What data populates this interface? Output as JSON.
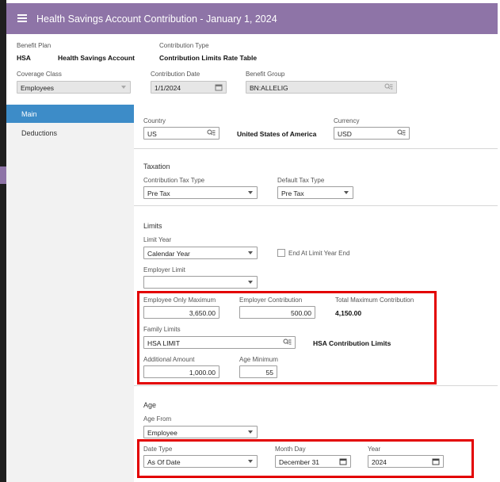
{
  "window": {
    "title": "Health Savings Account Contribution - January 1, 2024"
  },
  "header": {
    "benefit_plan_label": "Benefit Plan",
    "benefit_plan_code": "HSA",
    "benefit_plan_name": "Health Savings Account",
    "contribution_type_label": "Contribution Type",
    "contribution_type_value": "Contribution Limits Rate Table",
    "coverage_class_label": "Coverage Class",
    "coverage_class_value": "Employees",
    "contribution_date_label": "Contribution Date",
    "contribution_date_value": "1/1/2024",
    "benefit_group_label": "Benefit Group",
    "benefit_group_value": "BN:ALLELIG"
  },
  "sidebar": {
    "items": [
      {
        "label": "Main",
        "active": true
      },
      {
        "label": "Deductions",
        "active": false
      }
    ]
  },
  "main": {
    "country_label": "Country",
    "country_value": "US",
    "country_desc": "United States of America",
    "currency_label": "Currency",
    "currency_value": "USD",
    "taxation": {
      "title": "Taxation",
      "tax_type_label": "Contribution Tax Type",
      "tax_type_value": "Pre Tax",
      "default_tax_label": "Default Tax Type",
      "default_tax_value": "Pre Tax"
    },
    "limits": {
      "title": "Limits",
      "limit_year_label": "Limit Year",
      "limit_year_value": "Calendar Year",
      "end_at_limit_label": "End At Limit Year End",
      "end_at_limit_checked": false,
      "employer_limit_label": "Employer Limit",
      "employer_limit_value": "",
      "employee_only_max_label": "Employee Only Maximum",
      "employee_only_max_value": "3,650.00",
      "employer_contrib_label": "Employer Contribution",
      "employer_contrib_value": "500.00",
      "total_max_label": "Total Maximum Contribution",
      "total_max_value": "4,150.00",
      "family_limits_label": "Family Limits",
      "family_limits_value": "HSA LIMIT",
      "family_limits_desc": "HSA Contribution Limits",
      "additional_amount_label": "Additional Amount",
      "additional_amount_value": "1,000.00",
      "age_minimum_label": "Age Minimum",
      "age_minimum_value": "55"
    },
    "age": {
      "title": "Age",
      "age_from_label": "Age From",
      "age_from_value": "Employee",
      "date_type_label": "Date Type",
      "date_type_value": "As Of Date",
      "month_day_label": "Month Day",
      "month_day_value": "December 31",
      "year_label": "Year",
      "year_value": "2024"
    }
  },
  "colors": {
    "titlebar": "#8e74a7",
    "sidebar_active": "#3d8cc8",
    "highlight_box": "#e30000"
  },
  "icons": {
    "menu": "hamburger-icon",
    "lookup": "lookup-icon",
    "calendar": "calendar-icon",
    "dropdown": "chevron-down-icon"
  }
}
